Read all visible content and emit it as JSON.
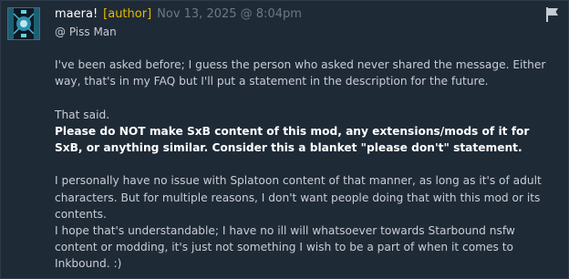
{
  "comment": {
    "author": "maera!",
    "author_tag": "[author]",
    "timestamp": "Nov 13, 2025 @ 8:04pm",
    "reply_to": "@ Piss Man",
    "icons": {
      "avatar": "user-avatar",
      "report": "flag-icon"
    },
    "paragraphs": [
      {
        "text": "I've been asked before; I guess the person who asked never shared the message. Either way, that's in my FAQ but I'll put a statement in the description for the future."
      },
      {
        "text": "That said."
      },
      {
        "bold": "Please do NOT make SxB content of this mod, any extensions/mods of it for SxB, or anything similar. Consider this a blanket \"please don't\" statement."
      },
      {
        "text": "I personally have no issue with Splatoon content of that manner, as long as it's of adult characters. But for multiple reasons, I don't want people doing that with this mod or its contents."
      },
      {
        "text": "I hope that's understandable; I have no ill will whatsoever towards Starbound nsfw content or modding, it's just not something I wish to be a part of when it comes to Inkbound. :)"
      }
    ]
  },
  "colors": {
    "background": "#1f2a37",
    "author_tag": "#e8b800",
    "timestamp": "#6e7884",
    "body_text": "#c8cdd3"
  }
}
